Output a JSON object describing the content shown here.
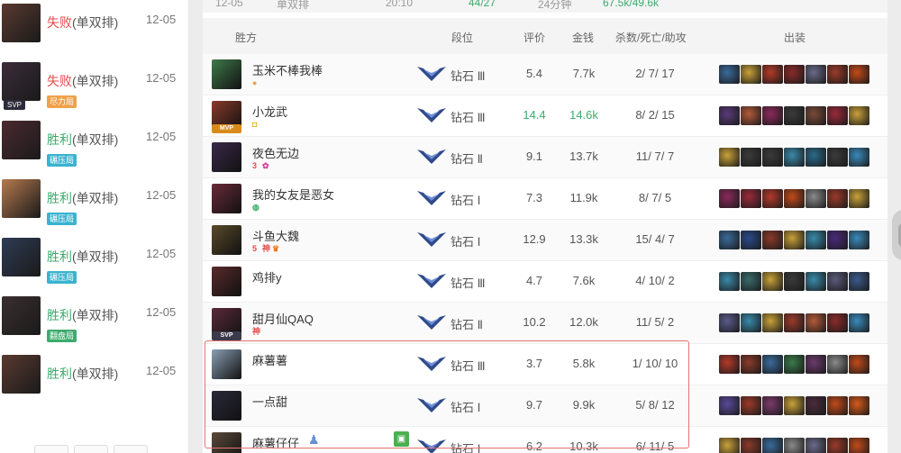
{
  "history": [
    {
      "result": "失败",
      "win": false,
      "mode": "(单双排)",
      "date": "12-05",
      "tag": "",
      "tag_color": "",
      "svp": "",
      "avatar_color": "#5a3a30"
    },
    {
      "result": "失败",
      "win": false,
      "mode": "(单双排)",
      "date": "12-05",
      "tag": "尽力局",
      "tag_color": "#f0a14a",
      "svp": "SVP",
      "avatar_color": "#3b2d3a"
    },
    {
      "result": "胜利",
      "win": true,
      "mode": "(单双排)",
      "date": "12-05",
      "tag": "碾压局",
      "tag_color": "#39b3cf",
      "svp": "",
      "avatar_color": "#4b2a30"
    },
    {
      "result": "胜利",
      "win": true,
      "mode": "(单双排)",
      "date": "12-05",
      "tag": "碾压局",
      "tag_color": "#39b3cf",
      "svp": "",
      "avatar_color": "#b77a4f"
    },
    {
      "result": "胜利",
      "win": true,
      "mode": "(单双排)",
      "date": "12-05",
      "tag": "碾压局",
      "tag_color": "#39b3cf",
      "svp": "",
      "avatar_color": "#2f3c55"
    },
    {
      "result": "胜利",
      "win": true,
      "mode": "(单双排)",
      "date": "12-05",
      "tag": "翻盘局",
      "tag_color": "#3cab6d",
      "svp": "",
      "avatar_color": "#3a2f2f"
    },
    {
      "result": "胜利",
      "win": true,
      "mode": "(单双排)",
      "date": "12-05",
      "tag": "",
      "tag_color": "",
      "svp": "",
      "avatar_color": "#5a3a30"
    }
  ],
  "summary_row": {
    "date": "12-05",
    "type": "单双排",
    "time": "20:10",
    "kills": "44/27",
    "duration": "24分钟",
    "gold": "67.5k/49.6k"
  },
  "table_header": {
    "team": "胜方",
    "rank": "段位",
    "score": "评价",
    "gold": "金钱",
    "kda": "杀数/死亡/助攻",
    "items": "出装"
  },
  "players": [
    {
      "name": "玉米不棒我棒",
      "rank": "钻石 Ⅲ",
      "score": "5.4",
      "gold": "7.7k",
      "kda": "2/ 7/ 17",
      "highlight": false,
      "mvp": "",
      "badges": [
        {
          "text": "●",
          "color": "#f0a14a"
        }
      ],
      "champ_color": "#3f7a4a",
      "items": [
        "#3a6a9a",
        "#c9a13a",
        "#b33a2a",
        "#8a2a2a",
        "#6a6a8a",
        "#9a3a2a",
        "#c24a1a"
      ],
      "friend": false,
      "share": false
    },
    {
      "name": "小龙武",
      "rank": "钻石 Ⅲ",
      "score": "14.4",
      "gold": "14.6k",
      "kda": "8/ 2/ 15",
      "highlight": true,
      "mvp": "MVP",
      "badges": [
        {
          "text": "◘",
          "color": "#e6a817"
        }
      ],
      "champ_color": "#8a3a2a",
      "items": [
        "#5a3a7a",
        "#b35a3a",
        "#8a2a5a",
        "#3a3a3a",
        "#7a4a3a",
        "#9a2a3a",
        "#c9a13a"
      ],
      "friend": false,
      "share": false
    },
    {
      "name": "夜色无边",
      "rank": "钻石 Ⅱ",
      "score": "9.1",
      "gold": "13.7k",
      "kda": "11/ 7/ 7",
      "highlight": false,
      "mvp": "",
      "badges": [
        {
          "text": "3",
          "color": "#e64a4a"
        },
        {
          "text": "✿",
          "color": "#d63a9a"
        }
      ],
      "champ_color": "#3a2a4a",
      "items": [
        "#c9a13a",
        "#3a3a3a",
        "#3a3a3a",
        "#3a8aaa",
        "#2a6a8a",
        "#3a3a3a",
        "#3a8abb"
      ],
      "friend": false,
      "share": false
    },
    {
      "name": "我的女友是恶女",
      "rank": "钻石 Ⅰ",
      "score": "7.3",
      "gold": "11.9k",
      "kda": "8/ 7/ 5",
      "highlight": false,
      "mvp": "",
      "badges": [
        {
          "text": "◍",
          "color": "#3cab6d"
        }
      ],
      "champ_color": "#6a2a3a",
      "items": [
        "#8a2a5a",
        "#9a2a3a",
        "#b33a2a",
        "#c24a1a",
        "#8a8a8a",
        "#9a3a2a",
        "#c9a13a"
      ],
      "friend": false,
      "share": false
    },
    {
      "name": "斗鱼大魏",
      "rank": "钻石 Ⅰ",
      "score": "12.9",
      "gold": "13.3k",
      "kda": "15/ 4/ 7",
      "highlight": false,
      "mvp": "",
      "badges": [
        {
          "text": "5",
          "color": "#e64a4a"
        },
        {
          "text": "神",
          "color": "#e64a4a"
        },
        {
          "text": "♛",
          "color": "#f07a1a"
        }
      ],
      "champ_color": "#5a4a2a",
      "items": [
        "#3a6a9a",
        "#2a4a8a",
        "#8a3a2a",
        "#c9a13a",
        "#3a8aaa",
        "#4a2a7a",
        "#3a8abb"
      ],
      "friend": false,
      "share": false
    },
    {
      "name": "鸡排y",
      "rank": "钻石 Ⅲ",
      "score": "4.7",
      "gold": "7.6k",
      "kda": "4/ 10/ 2",
      "highlight": false,
      "mvp": "",
      "badges": [],
      "champ_color": "#5a2a2a",
      "items": [
        "#3a8aaa",
        "#3a6a6a",
        "#c9a13a",
        "#3a3a3a",
        "#3a8aaa",
        "#5a5a7a",
        "#3a5a8a"
      ],
      "friend": false,
      "share": false
    },
    {
      "name": "甜月仙QAQ",
      "rank": "钻石 Ⅱ",
      "score": "10.2",
      "gold": "12.0k",
      "kda": "11/ 5/ 2",
      "highlight": false,
      "mvp": "SVP",
      "badges": [
        {
          "text": "神",
          "color": "#e64a4a"
        }
      ],
      "champ_color": "#5a2a3a",
      "items": [
        "#5a5a8a",
        "#3a8aaa",
        "#c9a13a",
        "#9a3a2a",
        "#b35a3a",
        "#8a2a2a",
        "#3a8abb"
      ],
      "friend": false,
      "share": false
    },
    {
      "name": "麻薯薯",
      "rank": "钻石 Ⅲ",
      "score": "3.7",
      "gold": "5.8k",
      "kda": "1/ 10/ 10",
      "highlight": false,
      "mvp": "",
      "badges": [],
      "champ_color": "#8aa0b5",
      "items": [
        "#b33a2a",
        "#8a3a2a",
        "#3a6a9a",
        "#3a7a4a",
        "#6a3a6a",
        "#8a8a8a",
        "#c24a1a"
      ],
      "friend": false,
      "share": false
    },
    {
      "name": "一点甜",
      "rank": "钻石 Ⅰ",
      "score": "9.7",
      "gold": "9.9k",
      "kda": "5/ 8/ 12",
      "highlight": false,
      "mvp": "",
      "badges": [],
      "champ_color": "#2a2a3a",
      "items": [
        "#5a4a9a",
        "#9a3a2a",
        "#7a3a6a",
        "#c9a13a",
        "#4a2a3a",
        "#c24a1a",
        "#d65a1a"
      ],
      "friend": false,
      "share": false
    },
    {
      "name": "麻薯仔仔",
      "rank": "钻石 Ⅰ",
      "score": "6.2",
      "gold": "10.3k",
      "kda": "6/ 11/ 5",
      "highlight": false,
      "mvp": "",
      "badges": [],
      "champ_color": "#5a4a3a",
      "items": [
        "#c9a13a",
        "#8a3a2a",
        "#3a6a9a",
        "#8a8a8a",
        "#6a6a8a",
        "#9a3a2a",
        "#c24a1a"
      ],
      "friend": true,
      "share": true
    }
  ]
}
